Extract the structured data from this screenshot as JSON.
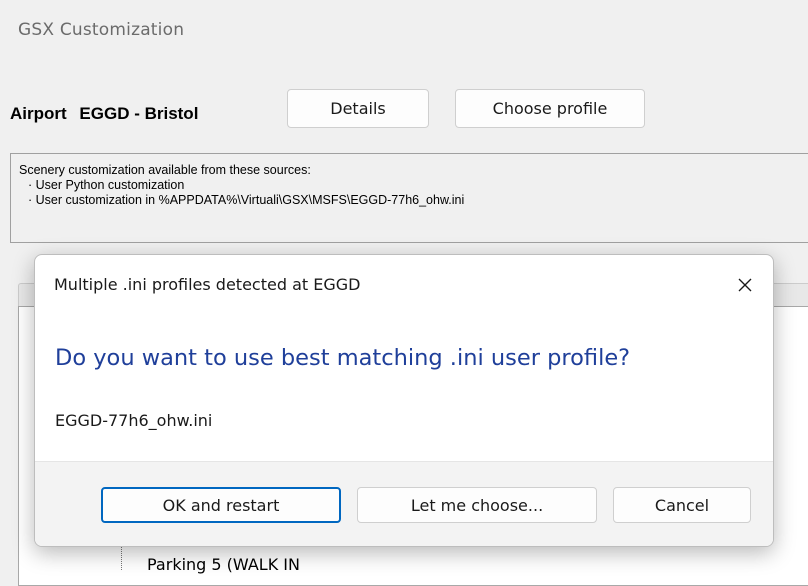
{
  "window": {
    "title": "GSX Customization"
  },
  "airport": {
    "label": "Airport",
    "value": "EGGD - Bristol",
    "details_button": "Details",
    "choose_profile_button": "Choose profile"
  },
  "sources": {
    "header": "Scenery customization available from these sources:",
    "items": [
      "· User Python customization",
      "· User customization in %APPDATA%\\Virtuali\\GSX\\MSFS\\EGGD-77h6_ohw.ini"
    ]
  },
  "background_tree": {
    "partial_item": "Parking 5 (WALK IN"
  },
  "dialog": {
    "title": "Multiple .ini profiles detected at EGGD",
    "close_icon": "close-icon",
    "heading": "Do you want to use best matching .ini user profile?",
    "filename": "EGGD-77h6_ohw.ini",
    "buttons": {
      "ok": "OK and restart",
      "choose": "Let me choose...",
      "cancel": "Cancel"
    },
    "heading_color": "#1f3f9a",
    "accent_color": "#0067c0"
  }
}
